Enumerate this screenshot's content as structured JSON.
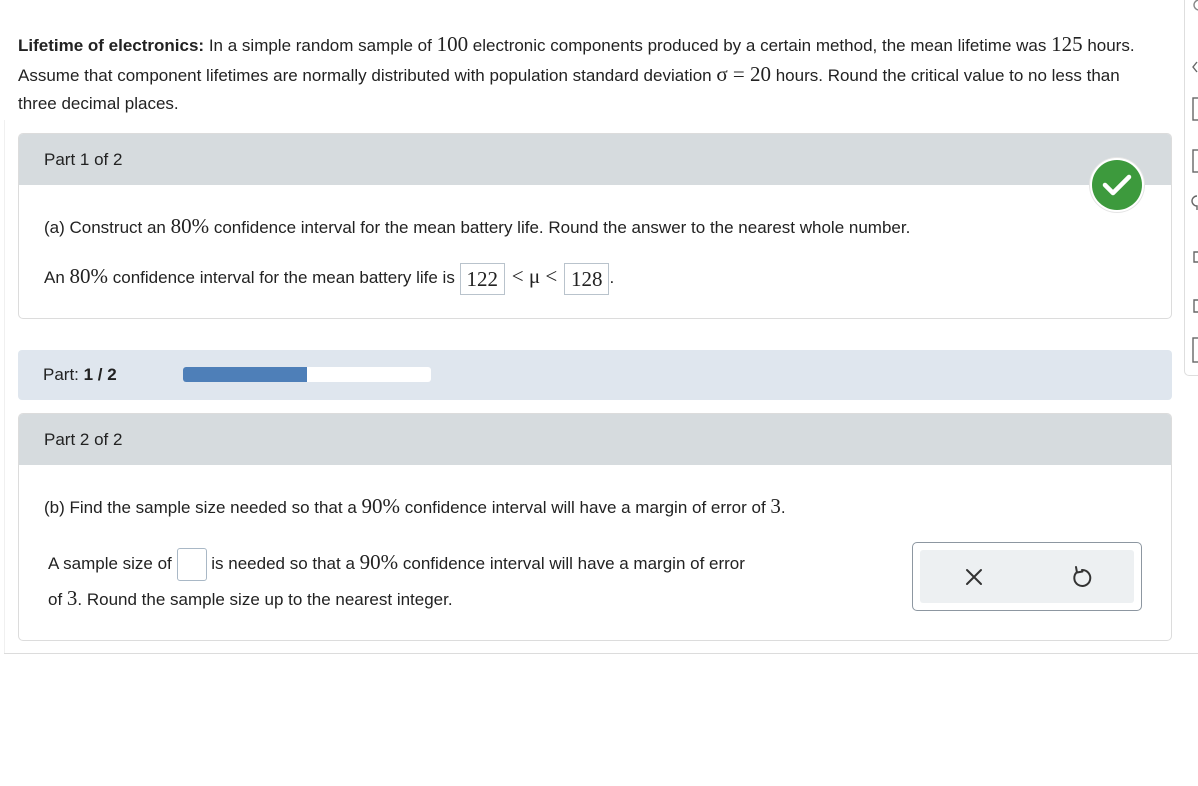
{
  "problem": {
    "title": "Lifetime of electronics:",
    "seg1": " In a simple random sample of ",
    "n": "100",
    "seg2": " electronic components produced by a certain method, the mean lifetime was ",
    "mean": "125",
    "seg3": " hours. Assume that component lifetimes are normally distributed with population standard deviation ",
    "sigma_expr": "σ = 20",
    "seg4": " hours. Round the critical value to no less than three decimal places."
  },
  "part1": {
    "header": "Part 1 of 2",
    "q_prefix": "(a) Construct an ",
    "q_conf": "80%",
    "q_suffix": " confidence interval for the mean battery life. Round the answer to the nearest whole number.",
    "a_prefix": "An ",
    "a_conf": "80%",
    "a_mid": " confidence interval for the mean battery life is ",
    "lower": "122",
    "ineq": "< μ <",
    "upper": "128",
    "period": ".",
    "status": "correct"
  },
  "progress": {
    "label": "Part: ",
    "value_text": "1 / 2",
    "fraction": 0.5
  },
  "part2": {
    "header": "Part 2 of 2",
    "q_prefix": "(b) Find the sample size needed so that a ",
    "q_conf": "90%",
    "q_mid": " confidence interval will have a margin of error of ",
    "q_moe": "3",
    "q_end": ".",
    "a_prefix": "A sample size of ",
    "a_mid": " is needed so that a ",
    "a_conf": "90%",
    "a_mid2": " confidence interval will have a margin of error",
    "a_line2_prefix": "of ",
    "a_moe": "3",
    "a_line2_suffix": ". Round the sample size up to the nearest integer.",
    "answer_value": ""
  },
  "icons": {
    "check": "check-icon",
    "clear": "close-icon",
    "undo": "undo-icon"
  },
  "colors": {
    "check_green": "#3d9a3d",
    "progress_fill": "#4e7fb8",
    "panel_header": "#d6dbde",
    "progress_bg": "#dfe6ee"
  }
}
